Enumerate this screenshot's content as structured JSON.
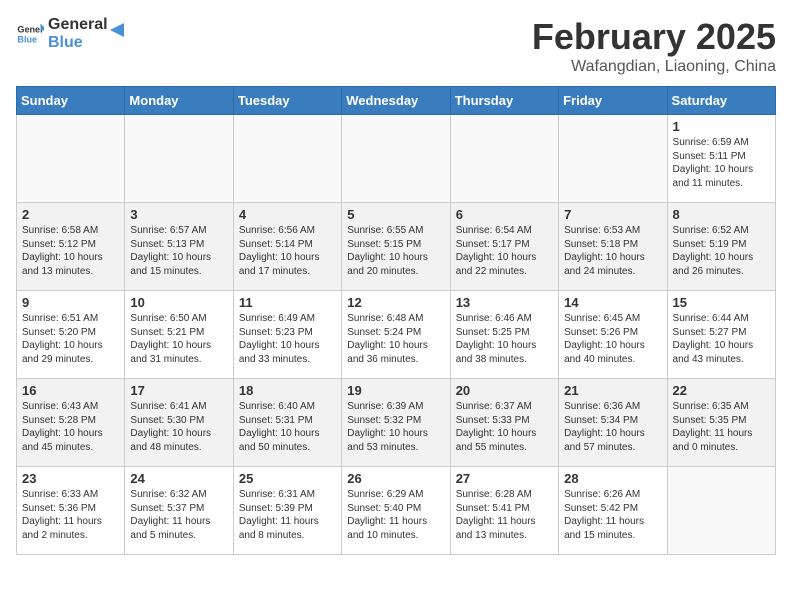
{
  "header": {
    "logo_general": "General",
    "logo_blue": "Blue",
    "title": "February 2025",
    "subtitle": "Wafangdian, Liaoning, China"
  },
  "weekdays": [
    "Sunday",
    "Monday",
    "Tuesday",
    "Wednesday",
    "Thursday",
    "Friday",
    "Saturday"
  ],
  "weeks": [
    [
      {
        "day": "",
        "info": ""
      },
      {
        "day": "",
        "info": ""
      },
      {
        "day": "",
        "info": ""
      },
      {
        "day": "",
        "info": ""
      },
      {
        "day": "",
        "info": ""
      },
      {
        "day": "",
        "info": ""
      },
      {
        "day": "1",
        "info": "Sunrise: 6:59 AM\nSunset: 5:11 PM\nDaylight: 10 hours\nand 11 minutes."
      }
    ],
    [
      {
        "day": "2",
        "info": "Sunrise: 6:58 AM\nSunset: 5:12 PM\nDaylight: 10 hours\nand 13 minutes."
      },
      {
        "day": "3",
        "info": "Sunrise: 6:57 AM\nSunset: 5:13 PM\nDaylight: 10 hours\nand 15 minutes."
      },
      {
        "day": "4",
        "info": "Sunrise: 6:56 AM\nSunset: 5:14 PM\nDaylight: 10 hours\nand 17 minutes."
      },
      {
        "day": "5",
        "info": "Sunrise: 6:55 AM\nSunset: 5:15 PM\nDaylight: 10 hours\nand 20 minutes."
      },
      {
        "day": "6",
        "info": "Sunrise: 6:54 AM\nSunset: 5:17 PM\nDaylight: 10 hours\nand 22 minutes."
      },
      {
        "day": "7",
        "info": "Sunrise: 6:53 AM\nSunset: 5:18 PM\nDaylight: 10 hours\nand 24 minutes."
      },
      {
        "day": "8",
        "info": "Sunrise: 6:52 AM\nSunset: 5:19 PM\nDaylight: 10 hours\nand 26 minutes."
      }
    ],
    [
      {
        "day": "9",
        "info": "Sunrise: 6:51 AM\nSunset: 5:20 PM\nDaylight: 10 hours\nand 29 minutes."
      },
      {
        "day": "10",
        "info": "Sunrise: 6:50 AM\nSunset: 5:21 PM\nDaylight: 10 hours\nand 31 minutes."
      },
      {
        "day": "11",
        "info": "Sunrise: 6:49 AM\nSunset: 5:23 PM\nDaylight: 10 hours\nand 33 minutes."
      },
      {
        "day": "12",
        "info": "Sunrise: 6:48 AM\nSunset: 5:24 PM\nDaylight: 10 hours\nand 36 minutes."
      },
      {
        "day": "13",
        "info": "Sunrise: 6:46 AM\nSunset: 5:25 PM\nDaylight: 10 hours\nand 38 minutes."
      },
      {
        "day": "14",
        "info": "Sunrise: 6:45 AM\nSunset: 5:26 PM\nDaylight: 10 hours\nand 40 minutes."
      },
      {
        "day": "15",
        "info": "Sunrise: 6:44 AM\nSunset: 5:27 PM\nDaylight: 10 hours\nand 43 minutes."
      }
    ],
    [
      {
        "day": "16",
        "info": "Sunrise: 6:43 AM\nSunset: 5:28 PM\nDaylight: 10 hours\nand 45 minutes."
      },
      {
        "day": "17",
        "info": "Sunrise: 6:41 AM\nSunset: 5:30 PM\nDaylight: 10 hours\nand 48 minutes."
      },
      {
        "day": "18",
        "info": "Sunrise: 6:40 AM\nSunset: 5:31 PM\nDaylight: 10 hours\nand 50 minutes."
      },
      {
        "day": "19",
        "info": "Sunrise: 6:39 AM\nSunset: 5:32 PM\nDaylight: 10 hours\nand 53 minutes."
      },
      {
        "day": "20",
        "info": "Sunrise: 6:37 AM\nSunset: 5:33 PM\nDaylight: 10 hours\nand 55 minutes."
      },
      {
        "day": "21",
        "info": "Sunrise: 6:36 AM\nSunset: 5:34 PM\nDaylight: 10 hours\nand 57 minutes."
      },
      {
        "day": "22",
        "info": "Sunrise: 6:35 AM\nSunset: 5:35 PM\nDaylight: 11 hours\nand 0 minutes."
      }
    ],
    [
      {
        "day": "23",
        "info": "Sunrise: 6:33 AM\nSunset: 5:36 PM\nDaylight: 11 hours\nand 2 minutes."
      },
      {
        "day": "24",
        "info": "Sunrise: 6:32 AM\nSunset: 5:37 PM\nDaylight: 11 hours\nand 5 minutes."
      },
      {
        "day": "25",
        "info": "Sunrise: 6:31 AM\nSunset: 5:39 PM\nDaylight: 11 hours\nand 8 minutes."
      },
      {
        "day": "26",
        "info": "Sunrise: 6:29 AM\nSunset: 5:40 PM\nDaylight: 11 hours\nand 10 minutes."
      },
      {
        "day": "27",
        "info": "Sunrise: 6:28 AM\nSunset: 5:41 PM\nDaylight: 11 hours\nand 13 minutes."
      },
      {
        "day": "28",
        "info": "Sunrise: 6:26 AM\nSunset: 5:42 PM\nDaylight: 11 hours\nand 15 minutes."
      },
      {
        "day": "",
        "info": ""
      }
    ]
  ]
}
